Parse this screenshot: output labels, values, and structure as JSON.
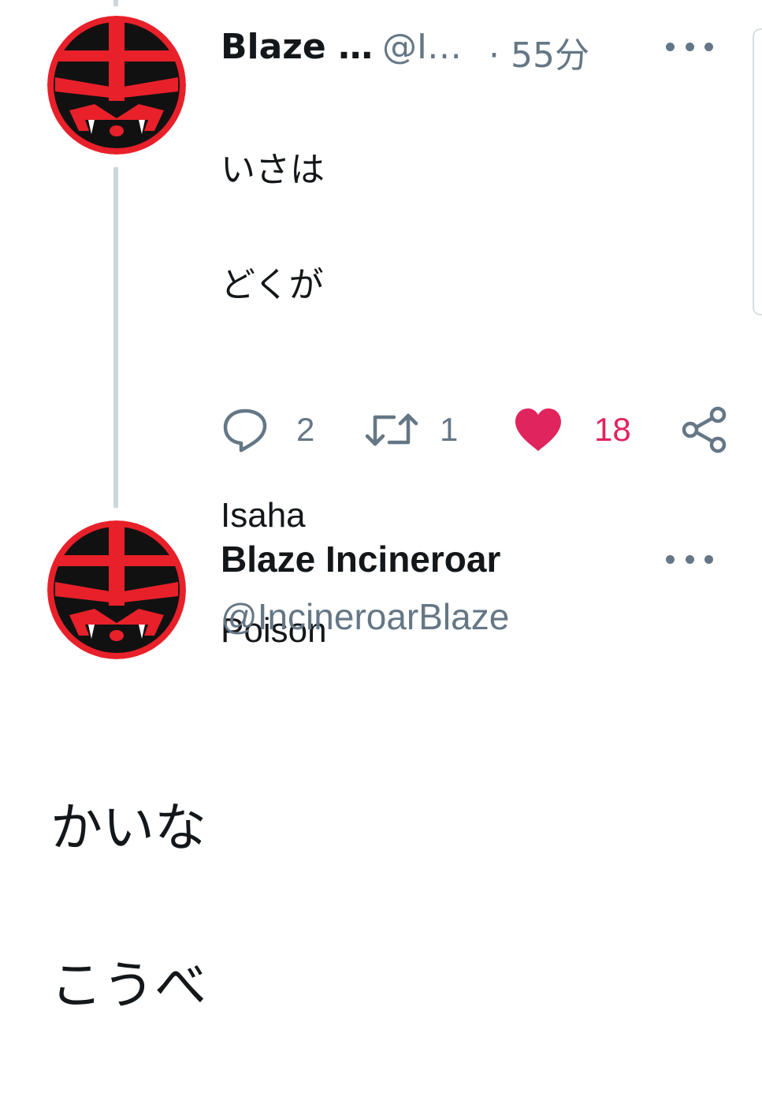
{
  "tweet1": {
    "display_name": "Blaze …",
    "handle": "@I…",
    "time_separator": "·",
    "time": "55分",
    "text_line_1": "いさは",
    "text_line_2": "どくが",
    "text_line_3": "Isaha",
    "text_line_4": "Poison",
    "actions": {
      "reply_count": "2",
      "retweet_count": "1",
      "like_count": "18",
      "liked": true
    }
  },
  "tweet2": {
    "display_name": "Blaze Incineroar",
    "handle": "@IncineroarBlaze",
    "text_line_1": "かいな",
    "text_line_2": "こうべ"
  },
  "icons": {
    "more": "more-dots-icon",
    "reply": "reply-bubble-icon",
    "retweet": "retweet-arrows-icon",
    "like": "heart-icon",
    "share": "share-icon"
  },
  "colors": {
    "avatar_red": "#e8202a",
    "avatar_black": "#111111",
    "like_pink": "#e0245e",
    "secondary_text": "#657786",
    "thread_line": "#ccd6dd"
  }
}
